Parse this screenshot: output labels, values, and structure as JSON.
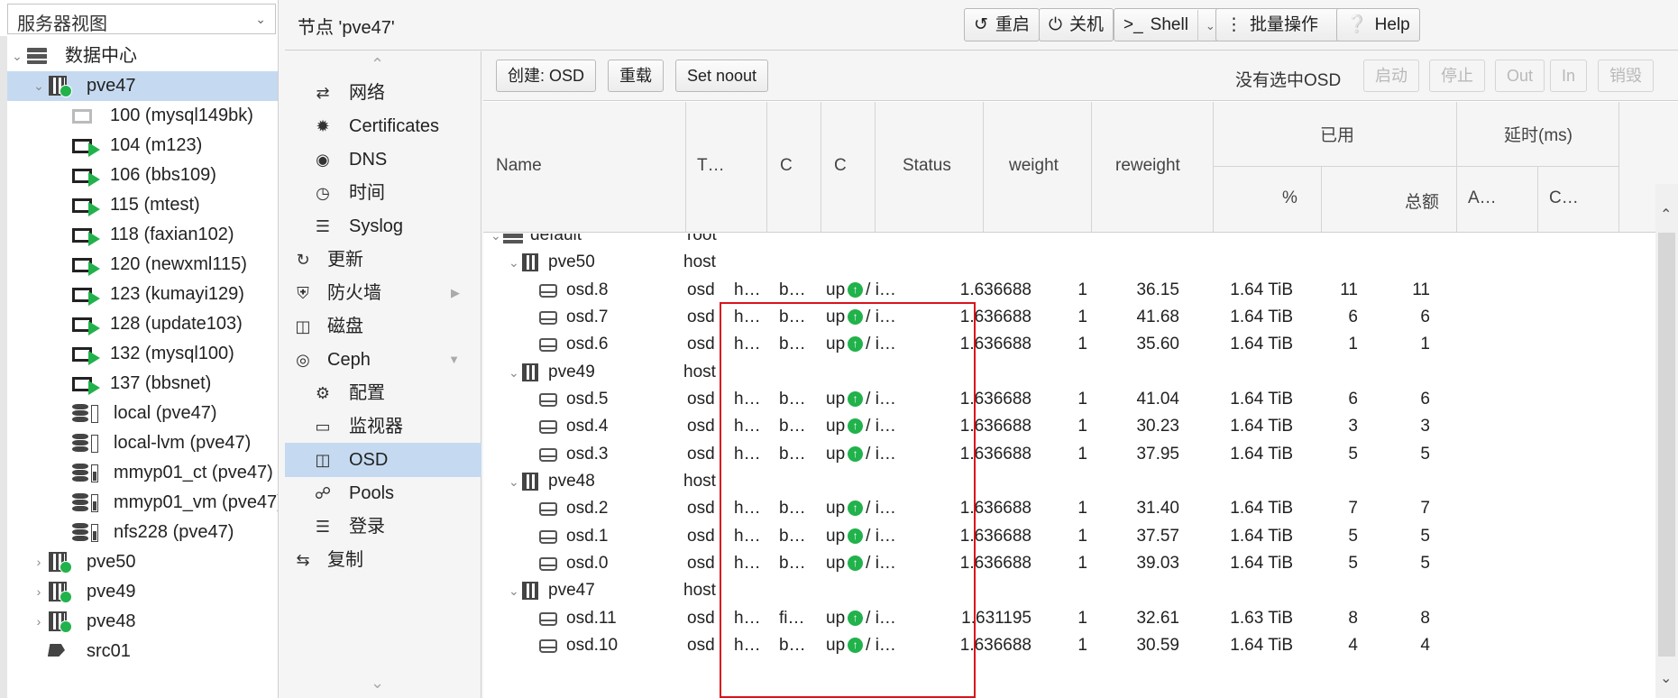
{
  "view_select": {
    "label": "服务器视图"
  },
  "tree": {
    "datacenter": "数据中心",
    "node_selected": "pve47",
    "vms": [
      {
        "label": "100 (mysql149bk)",
        "running": false
      },
      {
        "label": "104 (m123)",
        "running": true
      },
      {
        "label": "106 (bbs109)",
        "running": true
      },
      {
        "label": "115 (mtest)",
        "running": true
      },
      {
        "label": "118 (faxian102)",
        "running": true
      },
      {
        "label": "120 (newxml115)",
        "running": true
      },
      {
        "label": "123 (kumayi129)",
        "running": true
      },
      {
        "label": "128 (update103)",
        "running": true
      },
      {
        "label": "132 (mysql100)",
        "running": true
      },
      {
        "label": "137 (bbsnet)",
        "running": true
      }
    ],
    "storages": [
      {
        "label": "local (pve47)",
        "filled": false
      },
      {
        "label": "local-lvm (pve47)",
        "filled": false
      },
      {
        "label": "mmyp01_ct (pve47)",
        "filled": true
      },
      {
        "label": "mmyp01_vm (pve47)",
        "filled": true
      },
      {
        "label": "nfs228 (pve47)",
        "filled": true
      }
    ],
    "other_nodes": [
      "pve48",
      "pve49",
      "pve50"
    ],
    "pool": "src01"
  },
  "header": {
    "title": "节点 'pve47'",
    "reboot": "重启",
    "shutdown": "关机",
    "shell": "Shell",
    "bulk": "批量操作",
    "help": "Help"
  },
  "subnav": {
    "network": "网络",
    "certificates": "Certificates",
    "dns": "DNS",
    "time": "时间",
    "syslog": "Syslog",
    "updates": "更新",
    "firewall": "防火墙",
    "disks": "磁盘",
    "ceph": "Ceph",
    "config": "配置",
    "monitor": "监视器",
    "osd": "OSD",
    "pools": "Pools",
    "log": "登录",
    "replication": "复制"
  },
  "toolbar": {
    "create": "创建: OSD",
    "reload": "重载",
    "noout": "Set noout",
    "no_selection": "没有选中OSD",
    "start": "启动",
    "stop": "停止",
    "out": "Out",
    "in": "In",
    "destroy": "销毁"
  },
  "columns": {
    "name": "Name",
    "type": "T…",
    "c1": "C",
    "c2": "C",
    "status": "Status",
    "weight": "weight",
    "reweight": "reweight",
    "used": "已用",
    "used_pct": "%",
    "used_total": "总额",
    "latency": "延时(ms)",
    "lat_a": "A…",
    "lat_c": "C…"
  },
  "rows": [
    {
      "kind": "root",
      "name": "default",
      "type": "root"
    },
    {
      "kind": "host",
      "name": "pve50",
      "type": "host"
    },
    {
      "kind": "osd",
      "name": "osd.8",
      "type": "osd",
      "c1": "h…",
      "c2": "b…",
      "st": "up",
      "st2": "/ i…",
      "weight": "1.636688",
      "reweight": "1",
      "pct": "36.15",
      "total": "1.64 TiB",
      "a": "11",
      "c": "11"
    },
    {
      "kind": "osd",
      "name": "osd.7",
      "type": "osd",
      "c1": "h…",
      "c2": "b…",
      "st": "up",
      "st2": "/ i…",
      "weight": "1.636688",
      "reweight": "1",
      "pct": "41.68",
      "total": "1.64 TiB",
      "a": "6",
      "c": "6"
    },
    {
      "kind": "osd",
      "name": "osd.6",
      "type": "osd",
      "c1": "h…",
      "c2": "b…",
      "st": "up",
      "st2": "/ i…",
      "weight": "1.636688",
      "reweight": "1",
      "pct": "35.60",
      "total": "1.64 TiB",
      "a": "1",
      "c": "1"
    },
    {
      "kind": "host",
      "name": "pve49",
      "type": "host"
    },
    {
      "kind": "osd",
      "name": "osd.5",
      "type": "osd",
      "c1": "h…",
      "c2": "b…",
      "st": "up",
      "st2": "/ i…",
      "weight": "1.636688",
      "reweight": "1",
      "pct": "41.04",
      "total": "1.64 TiB",
      "a": "6",
      "c": "6"
    },
    {
      "kind": "osd",
      "name": "osd.4",
      "type": "osd",
      "c1": "h…",
      "c2": "b…",
      "st": "up",
      "st2": "/ i…",
      "weight": "1.636688",
      "reweight": "1",
      "pct": "30.23",
      "total": "1.64 TiB",
      "a": "3",
      "c": "3"
    },
    {
      "kind": "osd",
      "name": "osd.3",
      "type": "osd",
      "c1": "h…",
      "c2": "b…",
      "st": "up",
      "st2": "/ i…",
      "weight": "1.636688",
      "reweight": "1",
      "pct": "37.95",
      "total": "1.64 TiB",
      "a": "5",
      "c": "5"
    },
    {
      "kind": "host",
      "name": "pve48",
      "type": "host"
    },
    {
      "kind": "osd",
      "name": "osd.2",
      "type": "osd",
      "c1": "h…",
      "c2": "b…",
      "st": "up",
      "st2": "/ i…",
      "weight": "1.636688",
      "reweight": "1",
      "pct": "31.40",
      "total": "1.64 TiB",
      "a": "7",
      "c": "7"
    },
    {
      "kind": "osd",
      "name": "osd.1",
      "type": "osd",
      "c1": "h…",
      "c2": "b…",
      "st": "up",
      "st2": "/ i…",
      "weight": "1.636688",
      "reweight": "1",
      "pct": "37.57",
      "total": "1.64 TiB",
      "a": "5",
      "c": "5"
    },
    {
      "kind": "osd",
      "name": "osd.0",
      "type": "osd",
      "c1": "h…",
      "c2": "b…",
      "st": "up",
      "st2": "/ i…",
      "weight": "1.636688",
      "reweight": "1",
      "pct": "39.03",
      "total": "1.64 TiB",
      "a": "5",
      "c": "5"
    },
    {
      "kind": "host",
      "name": "pve47",
      "type": "host"
    },
    {
      "kind": "osd",
      "name": "osd.11",
      "type": "osd",
      "c1": "h…",
      "c2": "fi…",
      "st": "up",
      "st2": "/ i…",
      "weight": "1.631195",
      "reweight": "1",
      "pct": "32.61",
      "total": "1.63 TiB",
      "a": "8",
      "c": "8"
    },
    {
      "kind": "osd",
      "name": "osd.10",
      "type": "osd",
      "c1": "h…",
      "c2": "b…",
      "st": "up",
      "st2": "/ i…",
      "weight": "1.636688",
      "reweight": "1",
      "pct": "30.59",
      "total": "1.64 TiB",
      "a": "4",
      "c": "4"
    }
  ],
  "colors": {
    "selection": "#c5daf0",
    "running": "#21b24b",
    "highlight_box": "#d8141b"
  }
}
